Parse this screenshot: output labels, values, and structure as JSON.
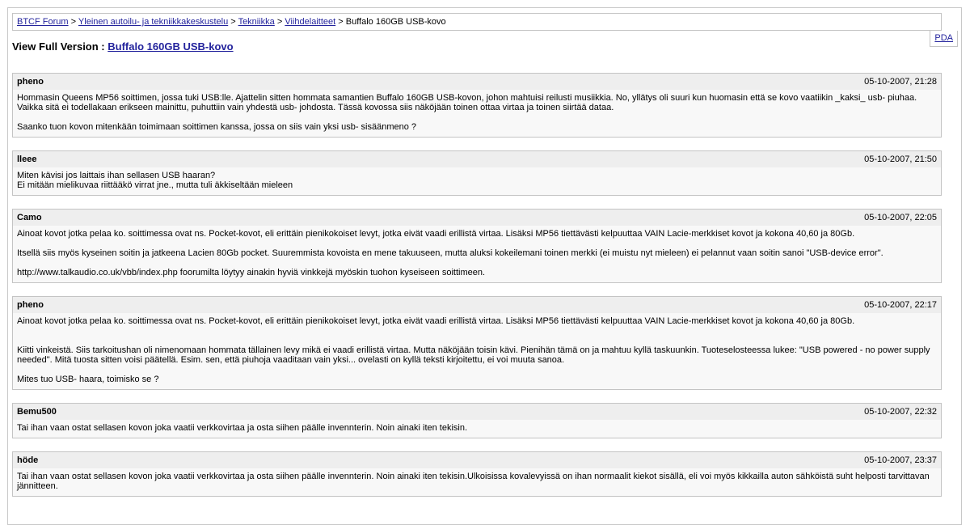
{
  "breadcrumb": {
    "items": [
      {
        "label": "BTCF Forum"
      },
      {
        "label": "Yleinen autoilu- ja tekniikkakeskustelu"
      },
      {
        "label": "Tekniikka"
      },
      {
        "label": "Viihdelaitteet"
      }
    ],
    "separator": ">",
    "current": "Buffalo 160GB USB-kovo"
  },
  "pda_link": "PDA",
  "page_title": {
    "prefix": "View Full Version :",
    "link": "Buffalo 160GB USB-kovo"
  },
  "posts": [
    {
      "author": "pheno",
      "date": "05-10-2007, 21:28",
      "body": "Hommasin Queens MP56 soittimen, jossa tuki USB:lle. Ajattelin sitten hommata samantien Buffalo 160GB USB-kovon, johon mahtuisi reilusti musiikkia. No, yllätys oli suuri kun huomasin että se kovo vaatiikin _kaksi_ usb- piuhaa. Vaikka sitä ei todellakaan erikseen mainittu, puhuttiin vain yhdestä usb- johdosta. Tässä kovossa siis näköjään toinen ottaa virtaa ja toinen siirtää dataa.\n\nSaanko tuon kovon mitenkään toimimaan soittimen kanssa, jossa on siis vain yksi usb- sisäänmeno ?"
    },
    {
      "author": "lleee",
      "date": "05-10-2007, 21:50",
      "body": "Miten kävisi jos laittais ihan sellasen USB haaran?\nEi mitään mielikuvaa riittääkö virrat jne., mutta tuli äkkiseltään mieleen"
    },
    {
      "author": "Camo",
      "date": "05-10-2007, 22:05",
      "body": "Ainoat kovot jotka pelaa ko. soittimessa ovat ns. Pocket-kovot, eli erittäin pienikokoiset levyt, jotka eivät vaadi erillistä virtaa. Lisäksi MP56 tiettävästi kelpuuttaa VAIN Lacie-merkkiset kovot ja kokona 40,60 ja 80Gb.\n\nItsellä siis myös kyseinen soitin ja jatkeena Lacien 80Gb pocket. Suuremmista kovoista en mene takuuseen, mutta aluksi kokeilemani toinen merkki (ei muistu nyt mieleen) ei pelannut vaan soitin sanoi \"USB-device error\".\n\nhttp://www.talkaudio.co.uk/vbb/index.php foorumilta löytyy ainakin hyviä vinkkejä myöskin tuohon kyseiseen soittimeen."
    },
    {
      "author": "pheno",
      "date": "05-10-2007, 22:17",
      "body": "Ainoat kovot jotka pelaa ko. soittimessa ovat ns. Pocket-kovot, eli erittäin pienikokoiset levyt, jotka eivät vaadi erillistä virtaa. Lisäksi MP56 tiettävästi kelpuuttaa VAIN Lacie-merkkiset kovot ja kokona 40,60 ja 80Gb.\n\n\nKiitti vinkeistä. Siis tarkoitushan oli nimenomaan hommata tällainen levy mikä ei vaadi erillistä virtaa. Mutta näköjään toisin kävi. Pienihän tämä on ja mahtuu kyllä taskuunkin. Tuoteselosteessa lukee: \"USB powered - no power supply needed\". Mitä tuosta sitten voisi päätellä. Esim. sen, että piuhoja vaaditaan vain yksi... ovelasti on kyllä teksti kirjoitettu, ei voi muuta sanoa.\n\nMites tuo USB- haara, toimisko se ?"
    },
    {
      "author": "Bemu500",
      "date": "05-10-2007, 22:32",
      "body": "Tai ihan vaan ostat sellasen kovon joka vaatii verkkovirtaa ja osta siihen päälle invennterin. Noin ainaki iten tekisin."
    },
    {
      "author": "höde",
      "date": "05-10-2007, 23:37",
      "body": "Tai ihan vaan ostat sellasen kovon joka vaatii verkkovirtaa ja osta siihen päälle invennterin. Noin ainaki iten tekisin.Ulkoisissa kovalevyissä on ihan normaalit kiekot sisällä, eli voi myös kikkailla auton sähköistä suht helposti tarvittavan jännitteen."
    }
  ]
}
